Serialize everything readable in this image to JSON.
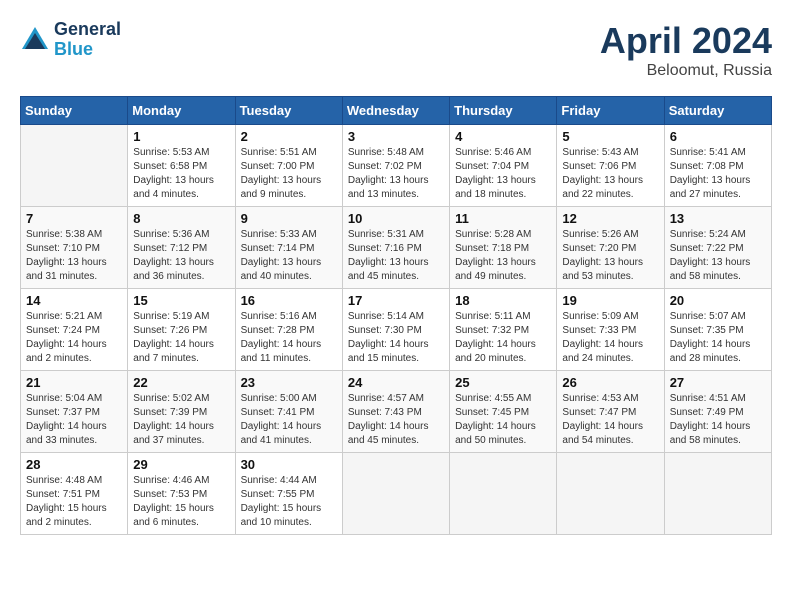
{
  "header": {
    "logo_line1": "General",
    "logo_line2": "Blue",
    "month_year": "April 2024",
    "location": "Beloomut, Russia"
  },
  "days_of_week": [
    "Sunday",
    "Monday",
    "Tuesday",
    "Wednesday",
    "Thursday",
    "Friday",
    "Saturday"
  ],
  "weeks": [
    [
      {
        "day": "",
        "info": ""
      },
      {
        "day": "1",
        "info": "Sunrise: 5:53 AM\nSunset: 6:58 PM\nDaylight: 13 hours\nand 4 minutes."
      },
      {
        "day": "2",
        "info": "Sunrise: 5:51 AM\nSunset: 7:00 PM\nDaylight: 13 hours\nand 9 minutes."
      },
      {
        "day": "3",
        "info": "Sunrise: 5:48 AM\nSunset: 7:02 PM\nDaylight: 13 hours\nand 13 minutes."
      },
      {
        "day": "4",
        "info": "Sunrise: 5:46 AM\nSunset: 7:04 PM\nDaylight: 13 hours\nand 18 minutes."
      },
      {
        "day": "5",
        "info": "Sunrise: 5:43 AM\nSunset: 7:06 PM\nDaylight: 13 hours\nand 22 minutes."
      },
      {
        "day": "6",
        "info": "Sunrise: 5:41 AM\nSunset: 7:08 PM\nDaylight: 13 hours\nand 27 minutes."
      }
    ],
    [
      {
        "day": "7",
        "info": "Sunrise: 5:38 AM\nSunset: 7:10 PM\nDaylight: 13 hours\nand 31 minutes."
      },
      {
        "day": "8",
        "info": "Sunrise: 5:36 AM\nSunset: 7:12 PM\nDaylight: 13 hours\nand 36 minutes."
      },
      {
        "day": "9",
        "info": "Sunrise: 5:33 AM\nSunset: 7:14 PM\nDaylight: 13 hours\nand 40 minutes."
      },
      {
        "day": "10",
        "info": "Sunrise: 5:31 AM\nSunset: 7:16 PM\nDaylight: 13 hours\nand 45 minutes."
      },
      {
        "day": "11",
        "info": "Sunrise: 5:28 AM\nSunset: 7:18 PM\nDaylight: 13 hours\nand 49 minutes."
      },
      {
        "day": "12",
        "info": "Sunrise: 5:26 AM\nSunset: 7:20 PM\nDaylight: 13 hours\nand 53 minutes."
      },
      {
        "day": "13",
        "info": "Sunrise: 5:24 AM\nSunset: 7:22 PM\nDaylight: 13 hours\nand 58 minutes."
      }
    ],
    [
      {
        "day": "14",
        "info": "Sunrise: 5:21 AM\nSunset: 7:24 PM\nDaylight: 14 hours\nand 2 minutes."
      },
      {
        "day": "15",
        "info": "Sunrise: 5:19 AM\nSunset: 7:26 PM\nDaylight: 14 hours\nand 7 minutes."
      },
      {
        "day": "16",
        "info": "Sunrise: 5:16 AM\nSunset: 7:28 PM\nDaylight: 14 hours\nand 11 minutes."
      },
      {
        "day": "17",
        "info": "Sunrise: 5:14 AM\nSunset: 7:30 PM\nDaylight: 14 hours\nand 15 minutes."
      },
      {
        "day": "18",
        "info": "Sunrise: 5:11 AM\nSunset: 7:32 PM\nDaylight: 14 hours\nand 20 minutes."
      },
      {
        "day": "19",
        "info": "Sunrise: 5:09 AM\nSunset: 7:33 PM\nDaylight: 14 hours\nand 24 minutes."
      },
      {
        "day": "20",
        "info": "Sunrise: 5:07 AM\nSunset: 7:35 PM\nDaylight: 14 hours\nand 28 minutes."
      }
    ],
    [
      {
        "day": "21",
        "info": "Sunrise: 5:04 AM\nSunset: 7:37 PM\nDaylight: 14 hours\nand 33 minutes."
      },
      {
        "day": "22",
        "info": "Sunrise: 5:02 AM\nSunset: 7:39 PM\nDaylight: 14 hours\nand 37 minutes."
      },
      {
        "day": "23",
        "info": "Sunrise: 5:00 AM\nSunset: 7:41 PM\nDaylight: 14 hours\nand 41 minutes."
      },
      {
        "day": "24",
        "info": "Sunrise: 4:57 AM\nSunset: 7:43 PM\nDaylight: 14 hours\nand 45 minutes."
      },
      {
        "day": "25",
        "info": "Sunrise: 4:55 AM\nSunset: 7:45 PM\nDaylight: 14 hours\nand 50 minutes."
      },
      {
        "day": "26",
        "info": "Sunrise: 4:53 AM\nSunset: 7:47 PM\nDaylight: 14 hours\nand 54 minutes."
      },
      {
        "day": "27",
        "info": "Sunrise: 4:51 AM\nSunset: 7:49 PM\nDaylight: 14 hours\nand 58 minutes."
      }
    ],
    [
      {
        "day": "28",
        "info": "Sunrise: 4:48 AM\nSunset: 7:51 PM\nDaylight: 15 hours\nand 2 minutes."
      },
      {
        "day": "29",
        "info": "Sunrise: 4:46 AM\nSunset: 7:53 PM\nDaylight: 15 hours\nand 6 minutes."
      },
      {
        "day": "30",
        "info": "Sunrise: 4:44 AM\nSunset: 7:55 PM\nDaylight: 15 hours\nand 10 minutes."
      },
      {
        "day": "",
        "info": ""
      },
      {
        "day": "",
        "info": ""
      },
      {
        "day": "",
        "info": ""
      },
      {
        "day": "",
        "info": ""
      }
    ]
  ]
}
